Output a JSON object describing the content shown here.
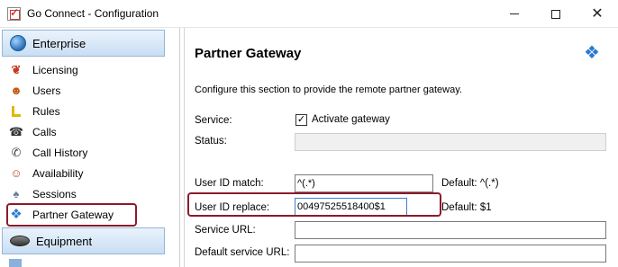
{
  "window": {
    "title": "Go Connect - Configuration"
  },
  "nav": {
    "enterprise_label": "Enterprise",
    "equipment_label": "Equipment",
    "items": [
      {
        "label": "Licensing",
        "icon": "ribbon-icon"
      },
      {
        "label": "Users",
        "icon": "user-icon"
      },
      {
        "label": "Rules",
        "icon": "rules-icon"
      },
      {
        "label": "Calls",
        "icon": "phone-icon"
      },
      {
        "label": "Call History",
        "icon": "call-history-icon"
      },
      {
        "label": "Availability",
        "icon": "availability-icon"
      },
      {
        "label": "Sessions",
        "icon": "sessions-icon"
      },
      {
        "label": "Partner Gateway",
        "icon": "puzzle-icon",
        "selected": true
      }
    ]
  },
  "panel": {
    "title": "Partner Gateway",
    "description": "Configure this section to provide the remote partner gateway.",
    "service_label": "Service:",
    "activate_label": "Activate gateway",
    "activate_checked": true,
    "status_label": "Status:",
    "status_value": "",
    "match_label": "User ID match:",
    "match_value": "^(.*)",
    "match_default": "Default: ^(.*)",
    "replace_label": "User ID replace:",
    "replace_value": "00497525518400$1",
    "replace_default": "Default: $1",
    "url_label": "Service URL:",
    "url_value": "",
    "default_url_label": "Default service URL:",
    "default_url_value": ""
  },
  "colors": {
    "highlight": "#8b1b2c",
    "header_gradient_top": "#eaf3fc",
    "header_gradient_bottom": "#c9def3"
  }
}
